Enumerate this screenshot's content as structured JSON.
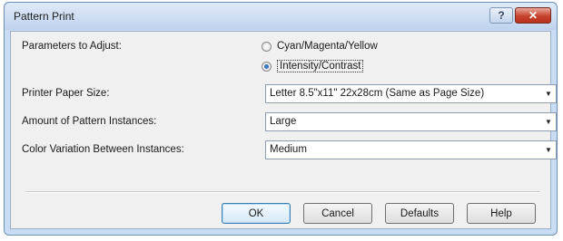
{
  "window": {
    "title": "Pattern Print",
    "help_glyph": "?",
    "close_glyph": "✕"
  },
  "params": {
    "label": "Parameters to Adjust:",
    "options": [
      {
        "label": "Cyan/Magenta/Yellow",
        "checked": false
      },
      {
        "label": "Intensity/Contrast",
        "checked": true
      }
    ]
  },
  "paper_size": {
    "label": "Printer Paper Size:",
    "value": "Letter 8.5\"x11\" 22x28cm (Same as Page Size)"
  },
  "amount": {
    "label": "Amount of Pattern Instances:",
    "value": "Large"
  },
  "variation": {
    "label": "Color Variation Between Instances:",
    "value": "Medium"
  },
  "buttons": {
    "ok": "OK",
    "cancel": "Cancel",
    "defaults": "Defaults",
    "help": "Help"
  },
  "icons": {
    "dropdown": "chevron-down-icon"
  }
}
